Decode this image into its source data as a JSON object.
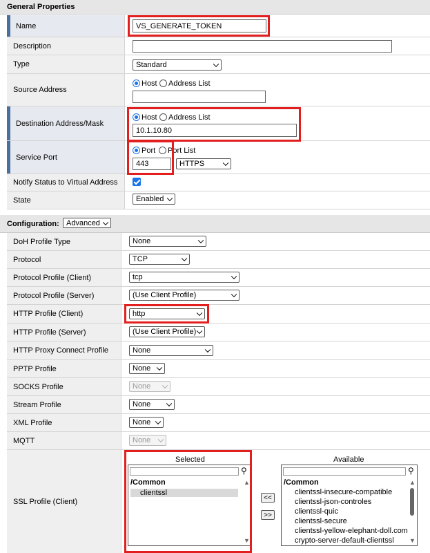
{
  "general": {
    "title": "General Properties",
    "name_label": "Name",
    "name_value": "VS_GENERATE_TOKEN",
    "description_label": "Description",
    "description_value": "",
    "type_label": "Type",
    "type_value": "Standard",
    "source_label": "Source Address",
    "source_radio_host": "Host",
    "source_radio_list": "Address List",
    "source_value": "",
    "dest_label": "Destination Address/Mask",
    "dest_radio_host": "Host",
    "dest_radio_list": "Address List",
    "dest_value": "10.1.10.80",
    "port_label": "Service Port",
    "port_radio_port": "Port",
    "port_radio_list": "Port List",
    "port_value": "443",
    "port_select": "HTTPS",
    "notify_label": "Notify Status to Virtual Address",
    "notify_checked": true,
    "state_label": "State",
    "state_value": "Enabled"
  },
  "configuration": {
    "title": "Configuration:",
    "mode": "Advanced",
    "rows": {
      "doh": {
        "label": "DoH Profile Type",
        "value": "None"
      },
      "protocol": {
        "label": "Protocol",
        "value": "TCP"
      },
      "proto_client": {
        "label": "Protocol Profile (Client)",
        "value": "tcp"
      },
      "proto_server": {
        "label": "Protocol Profile (Server)",
        "value": "(Use Client Profile)"
      },
      "http_client": {
        "label": "HTTP Profile (Client)",
        "value": "http"
      },
      "http_server": {
        "label": "HTTP Profile (Server)",
        "value": "(Use Client Profile)"
      },
      "http_proxy": {
        "label": "HTTP Proxy Connect Profile",
        "value": "None"
      },
      "pptp": {
        "label": "PPTP Profile",
        "value": "None"
      },
      "socks": {
        "label": "SOCKS Profile",
        "value": "None"
      },
      "stream": {
        "label": "Stream Profile",
        "value": "None"
      },
      "xml": {
        "label": "XML Profile",
        "value": "None"
      },
      "mqtt": {
        "label": "MQTT",
        "value": "None"
      }
    },
    "ssl": {
      "label": "SSL Profile (Client)",
      "selected_title": "Selected",
      "available_title": "Available",
      "selected_group": "/Common",
      "selected_items": [
        "clientssl"
      ],
      "available_group": "/Common",
      "available_items": [
        "clientssl-insecure-compatible",
        "clientssl-json-controles",
        "clientssl-quic",
        "clientssl-secure",
        "clientssl-yellow-elephant-doll.com",
        "crypto-server-default-clientssl"
      ],
      "move_left": "<<",
      "move_right": ">>"
    }
  },
  "highlight_color": "#e21e1e",
  "accent_color": "#1a73e8"
}
